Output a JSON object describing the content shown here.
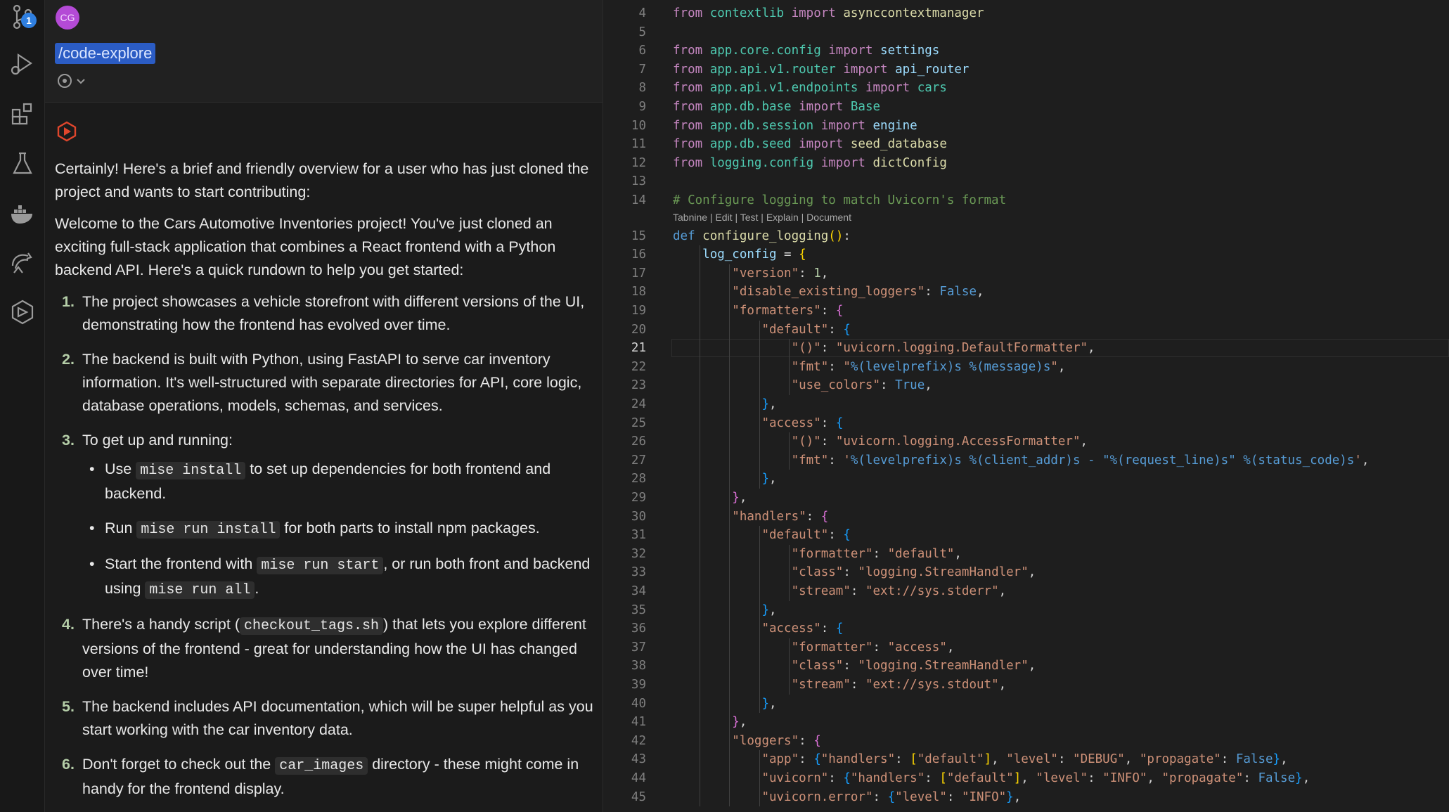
{
  "activity_bar": {
    "items": [
      {
        "icon": "source-control-icon",
        "badge": "1"
      },
      {
        "icon": "run-debug-icon"
      },
      {
        "icon": "extensions-icon"
      },
      {
        "icon": "testing-flask-icon"
      },
      {
        "icon": "docker-whale-icon"
      },
      {
        "icon": "remote-explorer-icon"
      },
      {
        "icon": "hexagon-extension-icon"
      }
    ]
  },
  "chat": {
    "avatar_initials": "CG",
    "command": "/code-explore",
    "intro": "Certainly! Here's a brief and friendly overview for a user who has just cloned the project and wants to start contributing:",
    "welcome": "Welcome to the Cars Automotive Inventories project! You've just cloned an exciting full-stack application that combines a React frontend with a Python backend API. Here's a quick rundown to help you get started:",
    "steps": [
      {
        "num": "1.",
        "text": "The project showcases a vehicle storefront with different versions of the UI, demonstrating how the frontend has evolved over time."
      },
      {
        "num": "2.",
        "text": "The backend is built with Python, using FastAPI to serve car inventory information. It's well-structured with separate directories for API, core logic, database operations, models, schemas, and services."
      },
      {
        "num": "3.",
        "text": "To get up and running:",
        "bullets": [
          {
            "pre": "Use ",
            "code": "mise install",
            "post": " to set up dependencies for both frontend and backend."
          },
          {
            "pre": "Run ",
            "code": "mise run install",
            "post": " for both parts to install npm packages."
          },
          {
            "pre": "Start the frontend with ",
            "code": "mise run start",
            "mid": ", or run both front and backend using ",
            "code2": "mise run all",
            "post": "."
          }
        ]
      },
      {
        "num": "4.",
        "pre": "There's a handy script (",
        "code": "checkout_tags.sh",
        "post": ") that lets you explore different versions of the frontend - great for understanding how the UI has changed over time!"
      },
      {
        "num": "5.",
        "text": "The backend includes API documentation, which will be super helpful as you start working with the car inventory data."
      },
      {
        "num": "6.",
        "pre": "Don't forget to check out the ",
        "code": "car_images",
        "post": " directory - these might come in handy for the frontend display."
      }
    ]
  },
  "editor": {
    "codelens": "Tabnine | Edit | Test | Explain | Document",
    "active_line": "21",
    "lines": [
      {
        "n": "4",
        "tokens": [
          [
            "kw",
            "from "
          ],
          [
            "mod",
            "contextlib"
          ],
          [
            "kw",
            " import "
          ],
          [
            "fn",
            "asynccontextmanager"
          ]
        ]
      },
      {
        "n": "5",
        "tokens": []
      },
      {
        "n": "6",
        "tokens": [
          [
            "kw",
            "from "
          ],
          [
            "mod",
            "app.core.config"
          ],
          [
            "kw",
            " import "
          ],
          [
            "var",
            "settings"
          ]
        ]
      },
      {
        "n": "7",
        "tokens": [
          [
            "kw",
            "from "
          ],
          [
            "mod",
            "app.api.v1.router"
          ],
          [
            "kw",
            " import "
          ],
          [
            "var",
            "api_router"
          ]
        ]
      },
      {
        "n": "8",
        "tokens": [
          [
            "kw",
            "from "
          ],
          [
            "mod",
            "app.api.v1.endpoints"
          ],
          [
            "kw",
            " import "
          ],
          [
            "mod",
            "cars"
          ]
        ]
      },
      {
        "n": "9",
        "tokens": [
          [
            "kw",
            "from "
          ],
          [
            "mod",
            "app.db.base"
          ],
          [
            "kw",
            " import "
          ],
          [
            "mod",
            "Base"
          ]
        ]
      },
      {
        "n": "10",
        "tokens": [
          [
            "kw",
            "from "
          ],
          [
            "mod",
            "app.db.session"
          ],
          [
            "kw",
            " import "
          ],
          [
            "var",
            "engine"
          ]
        ]
      },
      {
        "n": "11",
        "tokens": [
          [
            "kw",
            "from "
          ],
          [
            "mod",
            "app.db.seed"
          ],
          [
            "kw",
            " import "
          ],
          [
            "fn",
            "seed_database"
          ]
        ]
      },
      {
        "n": "12",
        "tokens": [
          [
            "kw",
            "from "
          ],
          [
            "mod",
            "logging.config"
          ],
          [
            "kw",
            " import "
          ],
          [
            "fn",
            "dictConfig"
          ]
        ]
      },
      {
        "n": "13",
        "tokens": []
      },
      {
        "n": "14",
        "tokens": [
          [
            "com",
            "# Configure logging to match Uvicorn's format"
          ]
        ]
      },
      {
        "n": "15",
        "tokens": [
          [
            "kd",
            "def "
          ],
          [
            "fn",
            "configure_logging"
          ],
          [
            "br1",
            "()"
          ],
          [
            "",
            ":"
          ]
        ]
      },
      {
        "n": "16",
        "tokens": [
          [
            "",
            "    "
          ],
          [
            "var",
            "log_config"
          ],
          [
            "",
            " = "
          ],
          [
            "br1",
            "{"
          ]
        ]
      },
      {
        "n": "17",
        "tokens": [
          [
            "",
            "        "
          ],
          [
            "str",
            "\"version\""
          ],
          [
            "",
            ": "
          ],
          [
            "num",
            "1"
          ],
          [
            "",
            ","
          ]
        ]
      },
      {
        "n": "18",
        "tokens": [
          [
            "",
            "        "
          ],
          [
            "str",
            "\"disable_existing_loggers\""
          ],
          [
            "",
            ": "
          ],
          [
            "kd",
            "False"
          ],
          [
            "",
            ","
          ]
        ]
      },
      {
        "n": "19",
        "tokens": [
          [
            "",
            "        "
          ],
          [
            "str",
            "\"formatters\""
          ],
          [
            "",
            ": "
          ],
          [
            "br2",
            "{"
          ]
        ]
      },
      {
        "n": "20",
        "tokens": [
          [
            "",
            "            "
          ],
          [
            "str",
            "\"default\""
          ],
          [
            "",
            ": "
          ],
          [
            "br3",
            "{"
          ]
        ]
      },
      {
        "n": "21",
        "tokens": [
          [
            "",
            "                "
          ],
          [
            "str",
            "\"()\""
          ],
          [
            "",
            ": "
          ],
          [
            "str",
            "\"uvicorn.logging.DefaultFormatter\""
          ],
          [
            "",
            ","
          ]
        ]
      },
      {
        "n": "22",
        "tokens": [
          [
            "",
            "                "
          ],
          [
            "str",
            "\"fmt\""
          ],
          [
            "",
            ": "
          ],
          [
            "str",
            "\""
          ],
          [
            "kd",
            "%(levelprefix)s %(message)s"
          ],
          [
            "str",
            "\""
          ],
          [
            "",
            ","
          ]
        ]
      },
      {
        "n": "23",
        "tokens": [
          [
            "",
            "                "
          ],
          [
            "str",
            "\"use_colors\""
          ],
          [
            "",
            ": "
          ],
          [
            "kd",
            "True"
          ],
          [
            "",
            ","
          ]
        ]
      },
      {
        "n": "24",
        "tokens": [
          [
            "",
            "            "
          ],
          [
            "br3",
            "}"
          ],
          [
            "",
            ","
          ]
        ]
      },
      {
        "n": "25",
        "tokens": [
          [
            "",
            "            "
          ],
          [
            "str",
            "\"access\""
          ],
          [
            "",
            ": "
          ],
          [
            "br3",
            "{"
          ]
        ]
      },
      {
        "n": "26",
        "tokens": [
          [
            "",
            "                "
          ],
          [
            "str",
            "\"()\""
          ],
          [
            "",
            ": "
          ],
          [
            "str",
            "\"uvicorn.logging.AccessFormatter\""
          ],
          [
            "",
            ","
          ]
        ]
      },
      {
        "n": "27",
        "tokens": [
          [
            "",
            "                "
          ],
          [
            "str",
            "\"fmt\""
          ],
          [
            "",
            ": "
          ],
          [
            "str",
            "'"
          ],
          [
            "kd",
            "%(levelprefix)s %(client_addr)s - \"%(request_line)s\" %(status_code)s"
          ],
          [
            "str",
            "'"
          ],
          [
            "",
            ","
          ]
        ]
      },
      {
        "n": "28",
        "tokens": [
          [
            "",
            "            "
          ],
          [
            "br3",
            "}"
          ],
          [
            "",
            ","
          ]
        ]
      },
      {
        "n": "29",
        "tokens": [
          [
            "",
            "        "
          ],
          [
            "br2",
            "}"
          ],
          [
            "",
            ","
          ]
        ]
      },
      {
        "n": "30",
        "tokens": [
          [
            "",
            "        "
          ],
          [
            "str",
            "\"handlers\""
          ],
          [
            "",
            ": "
          ],
          [
            "br2",
            "{"
          ]
        ]
      },
      {
        "n": "31",
        "tokens": [
          [
            "",
            "            "
          ],
          [
            "str",
            "\"default\""
          ],
          [
            "",
            ": "
          ],
          [
            "br3",
            "{"
          ]
        ]
      },
      {
        "n": "32",
        "tokens": [
          [
            "",
            "                "
          ],
          [
            "str",
            "\"formatter\""
          ],
          [
            "",
            ": "
          ],
          [
            "str",
            "\"default\""
          ],
          [
            "",
            ","
          ]
        ]
      },
      {
        "n": "33",
        "tokens": [
          [
            "",
            "                "
          ],
          [
            "str",
            "\"class\""
          ],
          [
            "",
            ": "
          ],
          [
            "str",
            "\"logging.StreamHandler\""
          ],
          [
            "",
            ","
          ]
        ]
      },
      {
        "n": "34",
        "tokens": [
          [
            "",
            "                "
          ],
          [
            "str",
            "\"stream\""
          ],
          [
            "",
            ": "
          ],
          [
            "str",
            "\"ext://sys.stderr\""
          ],
          [
            "",
            ","
          ]
        ]
      },
      {
        "n": "35",
        "tokens": [
          [
            "",
            "            "
          ],
          [
            "br3",
            "}"
          ],
          [
            "",
            ","
          ]
        ]
      },
      {
        "n": "36",
        "tokens": [
          [
            "",
            "            "
          ],
          [
            "str",
            "\"access\""
          ],
          [
            "",
            ": "
          ],
          [
            "br3",
            "{"
          ]
        ]
      },
      {
        "n": "37",
        "tokens": [
          [
            "",
            "                "
          ],
          [
            "str",
            "\"formatter\""
          ],
          [
            "",
            ": "
          ],
          [
            "str",
            "\"access\""
          ],
          [
            "",
            ","
          ]
        ]
      },
      {
        "n": "38",
        "tokens": [
          [
            "",
            "                "
          ],
          [
            "str",
            "\"class\""
          ],
          [
            "",
            ": "
          ],
          [
            "str",
            "\"logging.StreamHandler\""
          ],
          [
            "",
            ","
          ]
        ]
      },
      {
        "n": "39",
        "tokens": [
          [
            "",
            "                "
          ],
          [
            "str",
            "\"stream\""
          ],
          [
            "",
            ": "
          ],
          [
            "str",
            "\"ext://sys.stdout\""
          ],
          [
            "",
            ","
          ]
        ]
      },
      {
        "n": "40",
        "tokens": [
          [
            "",
            "            "
          ],
          [
            "br3",
            "}"
          ],
          [
            "",
            ","
          ]
        ]
      },
      {
        "n": "41",
        "tokens": [
          [
            "",
            "        "
          ],
          [
            "br2",
            "}"
          ],
          [
            "",
            ","
          ]
        ]
      },
      {
        "n": "42",
        "tokens": [
          [
            "",
            "        "
          ],
          [
            "str",
            "\"loggers\""
          ],
          [
            "",
            ": "
          ],
          [
            "br2",
            "{"
          ]
        ]
      },
      {
        "n": "43",
        "tokens": [
          [
            "",
            "            "
          ],
          [
            "str",
            "\"app\""
          ],
          [
            "",
            ": "
          ],
          [
            "br3",
            "{"
          ],
          [
            "str",
            "\"handlers\""
          ],
          [
            "",
            ": "
          ],
          [
            "br1",
            "["
          ],
          [
            "str",
            "\"default\""
          ],
          [
            "br1",
            "]"
          ],
          [
            "",
            ", "
          ],
          [
            "str",
            "\"level\""
          ],
          [
            "",
            ": "
          ],
          [
            "str",
            "\"DEBUG\""
          ],
          [
            "",
            ", "
          ],
          [
            "str",
            "\"propagate\""
          ],
          [
            "",
            ": "
          ],
          [
            "kd",
            "False"
          ],
          [
            "br3",
            "}"
          ],
          [
            "",
            ","
          ]
        ]
      },
      {
        "n": "44",
        "tokens": [
          [
            "",
            "            "
          ],
          [
            "str",
            "\"uvicorn\""
          ],
          [
            "",
            ": "
          ],
          [
            "br3",
            "{"
          ],
          [
            "str",
            "\"handlers\""
          ],
          [
            "",
            ": "
          ],
          [
            "br1",
            "["
          ],
          [
            "str",
            "\"default\""
          ],
          [
            "br1",
            "]"
          ],
          [
            "",
            ", "
          ],
          [
            "str",
            "\"level\""
          ],
          [
            "",
            ": "
          ],
          [
            "str",
            "\"INFO\""
          ],
          [
            "",
            ", "
          ],
          [
            "str",
            "\"propagate\""
          ],
          [
            "",
            ": "
          ],
          [
            "kd",
            "False"
          ],
          [
            "br3",
            "}"
          ],
          [
            "",
            ","
          ]
        ]
      },
      {
        "n": "45",
        "tokens": [
          [
            "",
            "            "
          ],
          [
            "str",
            "\"uvicorn.error\""
          ],
          [
            "",
            ": "
          ],
          [
            "br3",
            "{"
          ],
          [
            "str",
            "\"level\""
          ],
          [
            "",
            ": "
          ],
          [
            "str",
            "\"INFO\""
          ],
          [
            "br3",
            "}"
          ],
          [
            "",
            ","
          ]
        ]
      }
    ]
  }
}
